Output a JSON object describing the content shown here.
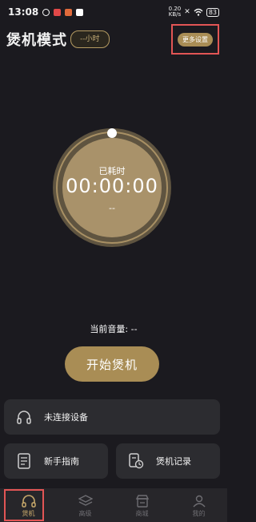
{
  "status_bar": {
    "time": "13:08",
    "network_speed": "0.20\nKB/s",
    "battery": "83"
  },
  "header": {
    "title": "煲机模式",
    "hours_pill": "--小时",
    "more_settings": "更多设置"
  },
  "dial": {
    "label": "已耗时",
    "time": "00:00:00",
    "sub": "--"
  },
  "volume": {
    "text": "当前音量: --"
  },
  "start_button": "开始煲机",
  "cards": {
    "device": "未连接设备",
    "guide": "新手指南",
    "records": "煲机记录"
  },
  "tabs": [
    {
      "label": "煲机",
      "icon": "headphones-icon",
      "active": true
    },
    {
      "label": "高级",
      "icon": "layers-icon",
      "active": false
    },
    {
      "label": "商城",
      "icon": "store-icon",
      "active": false
    },
    {
      "label": "我的",
      "icon": "profile-icon",
      "active": false
    }
  ],
  "colors": {
    "accent": "#a98d55",
    "background": "#1b1a1f",
    "card": "#2c2c30",
    "highlight": "#e25555"
  }
}
